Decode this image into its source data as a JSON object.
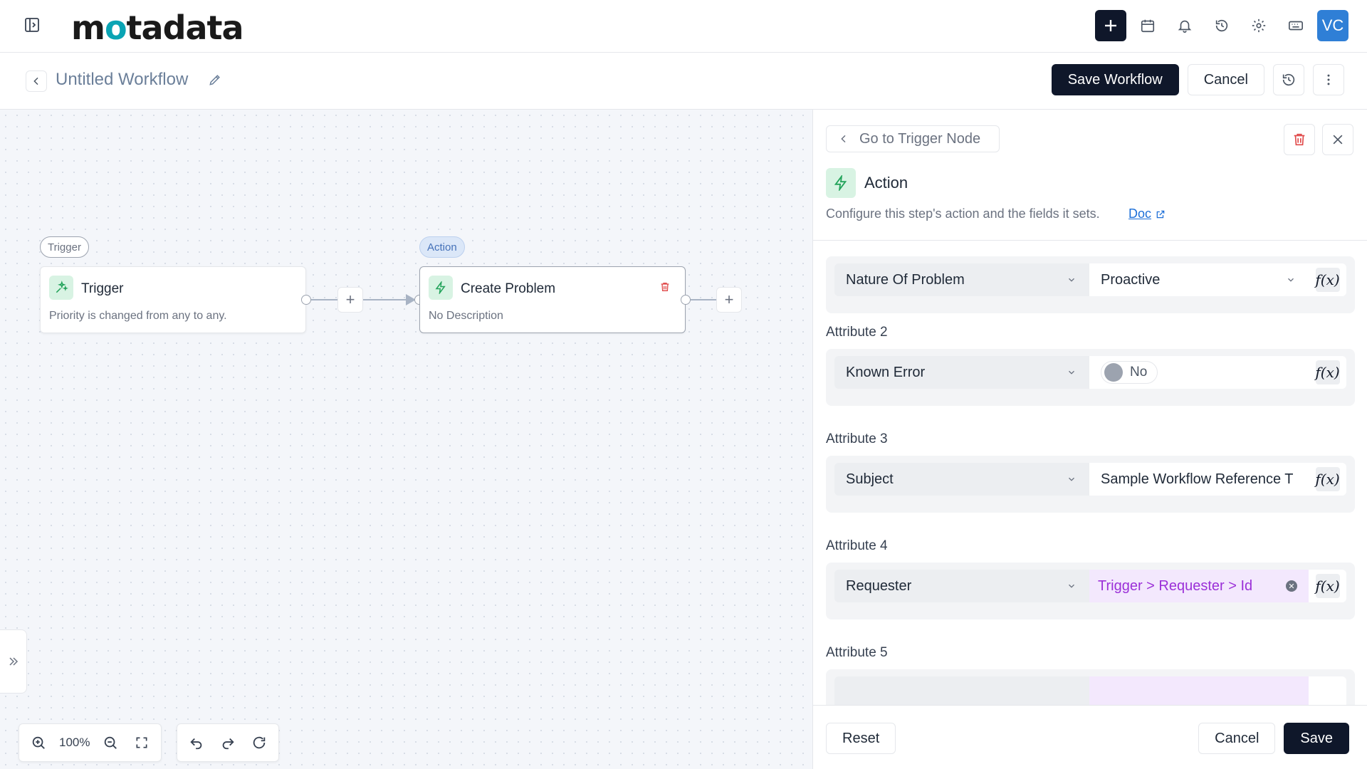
{
  "app": {
    "logo_text_1": "m",
    "logo_text_dot": "o",
    "logo_text_2": "tadata",
    "user_initials": "VC"
  },
  "workflow": {
    "title": "Untitled Workflow",
    "save_label": "Save Workflow",
    "cancel_label": "Cancel"
  },
  "canvas": {
    "trigger_chip": "Trigger",
    "action_chip": "Action",
    "trigger_node": {
      "title": "Trigger",
      "description": "Priority is changed from any to any."
    },
    "action_node": {
      "title": "Create Problem",
      "description": "No Description"
    },
    "add_symbol": "+",
    "zoom_level": "100%"
  },
  "panel": {
    "goto_label": "Go to Trigger Node",
    "title": "Action",
    "description": "Configure this step's action and the fields it sets.",
    "doc_label": "Doc",
    "fx_label": "f(x)",
    "attributes": [
      {
        "label": "",
        "field": "Nature Of Problem",
        "value": "Proactive",
        "type": "select"
      },
      {
        "label": "Attribute 2",
        "field": "Known Error",
        "value": "No",
        "type": "toggle"
      },
      {
        "label": "Attribute 3",
        "field": "Subject",
        "value": "Sample Workflow Reference T",
        "type": "text"
      },
      {
        "label": "Attribute 4",
        "field": "Requester",
        "value": "Trigger > Requester > Id",
        "type": "variable"
      },
      {
        "label": "Attribute 5",
        "field": "",
        "value": "",
        "type": "partial"
      }
    ],
    "footer": {
      "reset_label": "Reset",
      "cancel_label": "Cancel",
      "save_label": "Save"
    }
  },
  "colors": {
    "primary_dark": "#0f172a",
    "accent_green": "#22a35a",
    "variable_purple": "#9b30d8",
    "danger_red": "#e04848",
    "link_blue": "#1d6fd8"
  }
}
